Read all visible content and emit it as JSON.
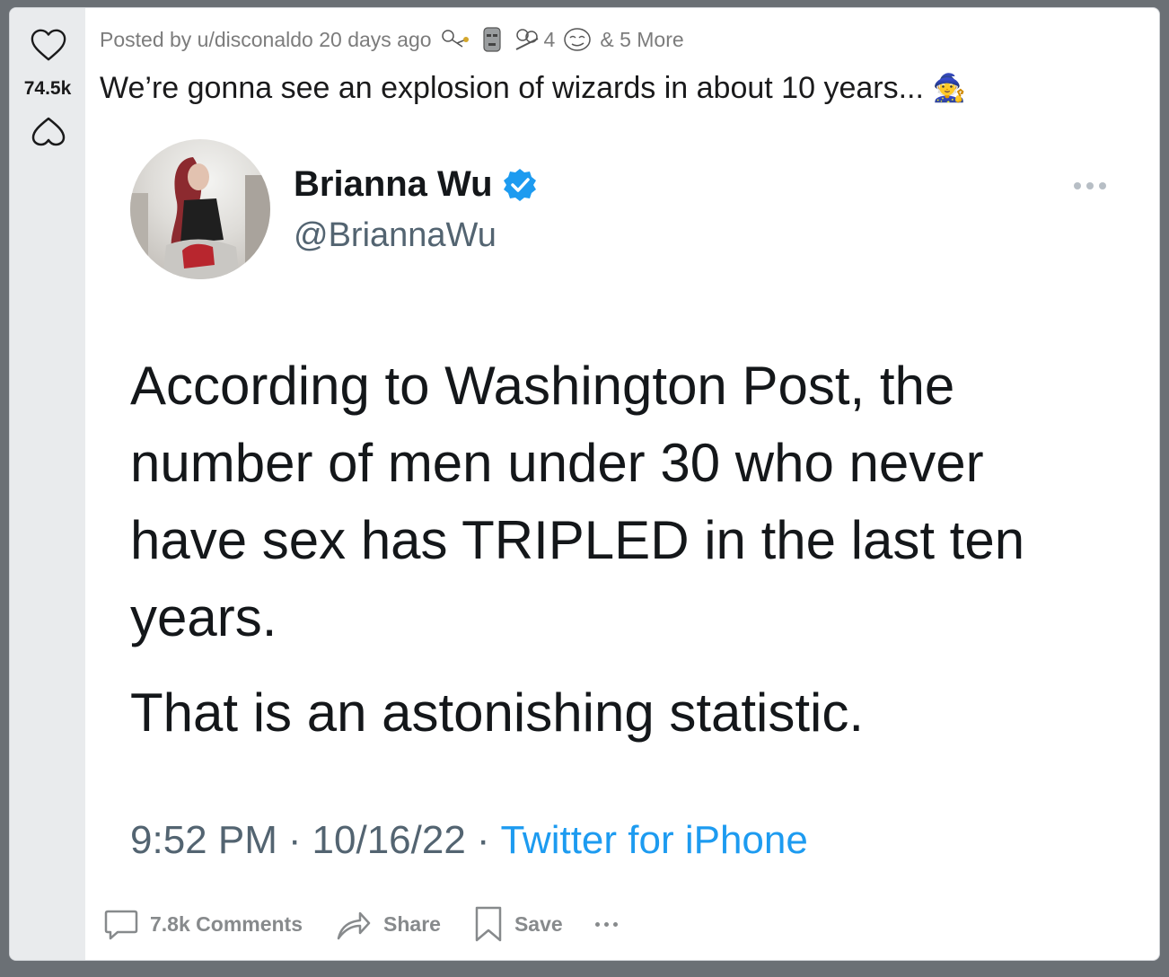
{
  "post": {
    "score": "74.5k",
    "meta": {
      "posted_by": "Posted by u/disconaldo 20 days ago",
      "award_count": "4",
      "more_awards": "& 5 More"
    },
    "title": "We’re gonna see an explosion of wizards in about 10 years...",
    "title_emoji": "🧙",
    "actions": {
      "comments": "7.8k Comments",
      "share": "Share",
      "save": "Save"
    }
  },
  "tweet": {
    "name": "Brianna Wu",
    "handle": "@BriannaWu",
    "text_1": "According to Washington Post, the number of men under 30 who never have sex has TRIPLED in the last ten years.",
    "text_2": "That is an astonishing statistic.",
    "time": "9:52 PM",
    "date": "10/16/22",
    "source": "Twitter for iPhone",
    "sep": "·"
  },
  "icons": {
    "upvote": "heart-outline-icon",
    "downvote": "heart-outline-down-icon",
    "verified": "verified-badge-icon",
    "comments": "comment-bubble-icon",
    "share": "share-arrow-icon",
    "save": "bookmark-icon",
    "more": "more-dots-icon"
  },
  "colors": {
    "verified": "#1d9bf0",
    "source_link": "#1d9bf0",
    "action_gray": "#878a8c",
    "vote_column": "#e9ebed"
  }
}
